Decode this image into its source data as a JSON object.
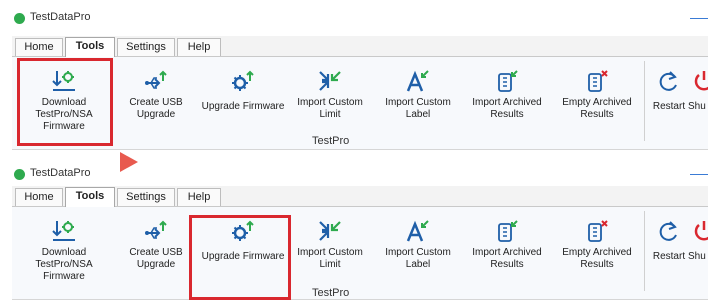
{
  "app_title": "TestDataPro",
  "tabs": [
    "Home",
    "Tools",
    "Settings",
    "Help"
  ],
  "buttons": [
    {
      "label": "Download TestPro/NSA Firmware",
      "icon": "download-firmware-icon"
    },
    {
      "label": "Create USB Upgrade",
      "icon": "usb-upgrade-icon"
    },
    {
      "label": "Upgrade Firmware",
      "icon": "upgrade-firmware-icon"
    },
    {
      "label": "Import Custom Limit",
      "icon": "import-custom-limit-icon"
    },
    {
      "label": "Import Custom Label",
      "icon": "import-custom-label-icon"
    },
    {
      "label": "Import Archived Results",
      "icon": "import-archived-results-icon"
    },
    {
      "label": "Empty Archived Results",
      "icon": "empty-archived-results-icon"
    },
    {
      "label": "Restart",
      "icon": "restart-icon"
    },
    {
      "label": "Shu",
      "icon": "shutdown-icon"
    }
  ],
  "group_label": "TestPro",
  "colors": {
    "icon_green": "#2eaa4e",
    "icon_blue": "#1f5fa8",
    "highlight": "#d9282f",
    "cursor": "#e85a4f"
  },
  "panel1": {
    "highlighted": "Download TestPro/NSA Firmware"
  },
  "panel2": {
    "highlighted": "Upgrade Firmware"
  }
}
